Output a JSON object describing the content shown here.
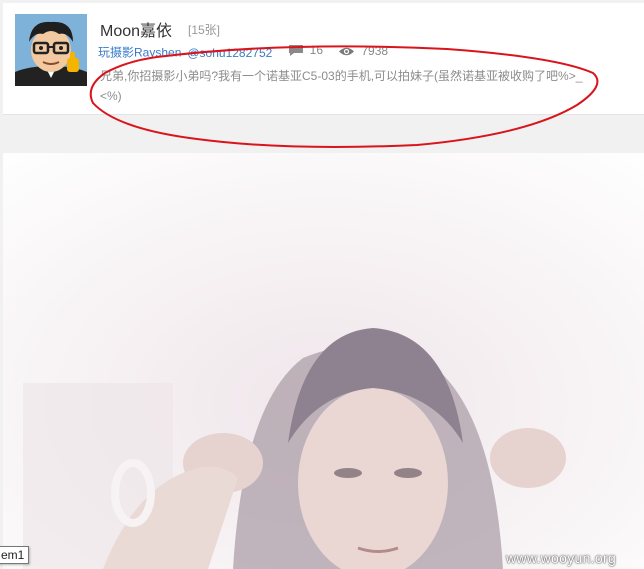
{
  "post": {
    "album_title": "Moon嘉依",
    "photo_count": "[15张]",
    "author_name": "玩摄影Rayshen",
    "author_handle": "@sohu1282752",
    "comments_count": "16",
    "views_count": "7938",
    "comment": "兄弟,你招摄影小弟吗?我有一个诺基亚C5-03的手机,可以拍妹子(虽然诺基亚被收购了吧%>_<%)"
  },
  "icons": {
    "comment": "comment-bubble-icon",
    "views": "eye-icon"
  },
  "tooltip": "em1",
  "watermark": "www.wooyun.org",
  "colors": {
    "link": "#3a7bc8",
    "annotation": "#d9141b",
    "page_background": "#f1f1f1"
  }
}
